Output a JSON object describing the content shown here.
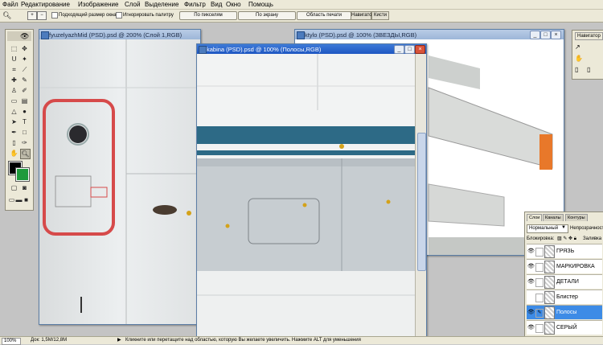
{
  "menu": [
    "Файл",
    "Редактирование",
    "Изображение",
    "Слой",
    "Выделение",
    "Фильтр",
    "Вид",
    "Окно",
    "Помощь"
  ],
  "options": {
    "fit_window_label": "Подходящий размер окна",
    "ignore_palettes_label": "Игнорировать палитру",
    "actual_pixels_label": "По пикселям",
    "fit_screen_label": "По экрану",
    "print_size_label": "Область печати",
    "tab_navigator": "Навигатор",
    "tab_brushes": "Кисти"
  },
  "windows": {
    "fuz": {
      "title": "fyuzelyazhMid (PSD).psd @ 200% (Слой 1,RGB)"
    },
    "kabina": {
      "title": "kabina (PSD).psd @ 100% (Полосы,RGB)"
    },
    "ktylo": {
      "title": "ktylo (PSD).psd @ 100% (ЗВЕЗДЫ,RGB)"
    }
  },
  "navigator": {
    "title": "Навигатор"
  },
  "layers_panel": {
    "tabs": [
      "Слои",
      "Каналы",
      "Контуры"
    ],
    "blend_mode": "Нормальный",
    "opacity_label": "Непрозрачность",
    "lock_label": "Блокировка:",
    "fill_label": "Заливка",
    "layers": [
      {
        "name": "ГРЯЗЬ",
        "visible": true,
        "selected": false
      },
      {
        "name": "МАРКИРОВКА",
        "visible": true,
        "selected": false
      },
      {
        "name": "ДЕТАЛИ",
        "visible": true,
        "selected": false
      },
      {
        "name": "Блистер",
        "visible": false,
        "selected": false
      },
      {
        "name": "Полосы",
        "visible": true,
        "selected": true
      },
      {
        "name": "СЕРЫЙ",
        "visible": true,
        "selected": false
      }
    ]
  },
  "status": {
    "zoom": "100%",
    "doc": "Док: 1,5M/12,8M",
    "hint": "Кликните или перетащите над областью, которую Вы желаете увеличить. Нажмите ALT для уменьшения"
  },
  "colors": {
    "accent_blue": "#2d6a86",
    "selection_blue": "#3d8be6",
    "title_active": "#1e56c2",
    "red_outline": "#d64a4a",
    "orange": "#e8782a"
  }
}
